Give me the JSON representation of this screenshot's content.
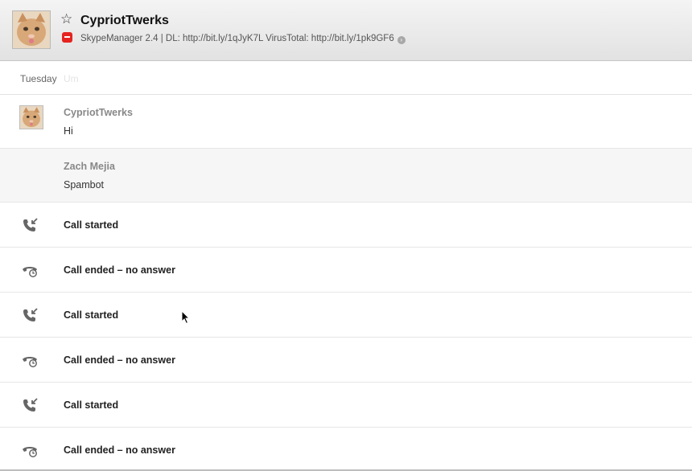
{
  "header": {
    "contact_name": "CypriotTwerks",
    "mood": "SkypeManager 2.4 |  DL: http://bit.ly/1qJyK7L  VirusTotal: http://bit.ly/1pk9GF6"
  },
  "conversation": {
    "day_label": "Tuesday",
    "day_ghost_text": "Um",
    "messages": [
      {
        "author": "CypriotTwerks",
        "text": "Hi",
        "has_avatar": true
      },
      {
        "author": "Zach Mejia",
        "text": "Spambot",
        "has_avatar": false
      }
    ],
    "calls": [
      {
        "icon": "call-incoming-icon",
        "label": "Call started"
      },
      {
        "icon": "call-ended-icon",
        "label": "Call ended – no answer"
      },
      {
        "icon": "call-incoming-icon",
        "label": "Call started"
      },
      {
        "icon": "call-ended-icon",
        "label": "Call ended – no answer"
      },
      {
        "icon": "call-incoming-icon",
        "label": "Call started"
      },
      {
        "icon": "call-ended-icon",
        "label": "Call ended – no answer"
      }
    ]
  },
  "colors": {
    "status_red": "#e52420",
    "icon_gray": "#666666",
    "author_gray": "#888888"
  }
}
